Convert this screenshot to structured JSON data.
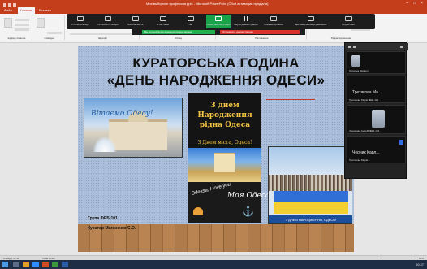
{
  "window": {
    "title": "Мое выборное профессия.pptx - Microsoft PowerPoint (Сбой активации продукта)"
  },
  "ribbon_tabs": [
    "Файл",
    "Главная",
    "Вставка"
  ],
  "ribbon_groups": [
    "Буфер обмена",
    "Слайды",
    "Шрифт",
    "Абзац",
    "Рисование",
    "Редактирование"
  ],
  "zoom_toolbar": {
    "buttons": [
      "Отключить звук",
      "Остановить видео",
      "Безопасность",
      "Участники",
      "Чат",
      "Новая демонстрация",
      "Пауза демонстрации",
      "Комментировать",
      "Дистанционное управление",
      "Подробнее"
    ],
    "share_notice": "Вы осуществляете демонстрацию экрана",
    "stop_share": "Остановить демонстрацию"
  },
  "slide": {
    "title_line1": "КУРАТОРСЬКА ГОДИНА",
    "title_line2": "«ДЕНЬ НАРОДЖЕННЯ ОДЕСИ»",
    "pic1_caption": "Вітаємо Одесу!",
    "card_text": "З днем Народження рідна Одеса",
    "card_subtext": "З Днем міста, Одеса!",
    "card2_text_a": "Odessa, I love you!",
    "card2_text_b": "Моя Одеса",
    "pic3_caption": "З ДНЕМ НАРОДЖЕННЯ, ОДЕСО!",
    "group": "Група ФЕБ-101",
    "curator": "Куратор Маганенко С.О."
  },
  "participants": [
    {
      "name": "Остапюк Михаил"
    },
    {
      "name": "Третякова Ма..."
    },
    {
      "name": "Третякова Марія ФЕБ-101"
    },
    {
      "name": "Чернікова Андрій ФЕБ-101"
    },
    {
      "name": "Черник Карл..."
    },
    {
      "name": "Третякова Марія..."
    }
  ],
  "statusbar": {
    "slide_info": "Слайд 1 из 11",
    "theme": "Тема Office",
    "zoom": "69%"
  },
  "clock": "10:47"
}
